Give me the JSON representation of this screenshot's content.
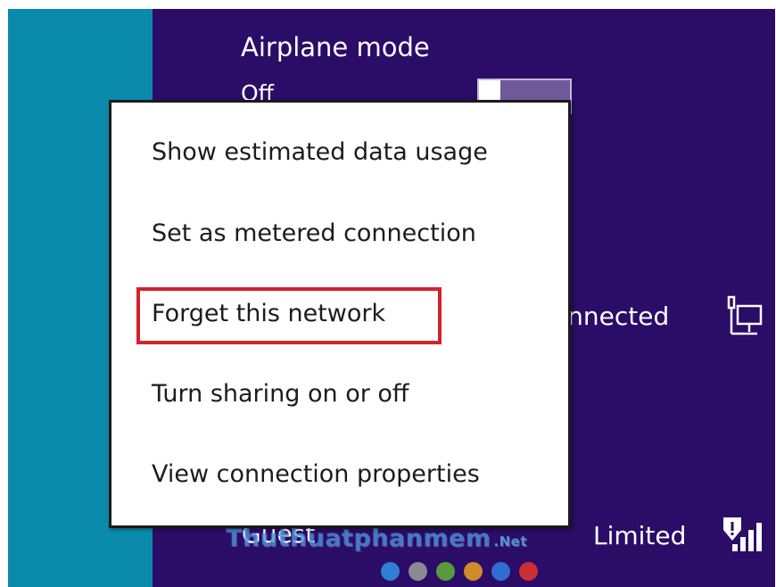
{
  "colors": {
    "left_pane": "#0b8bab",
    "network_pane": "#2b0c67",
    "menu_background": "#ffffff",
    "highlight": "#d4212c"
  },
  "airplane_mode": {
    "title": "Airplane mode",
    "state": "Off"
  },
  "networks": [
    {
      "name": "",
      "status": "onnected",
      "icon": "ethernet-icon"
    },
    {
      "name": "Guest",
      "status": "Limited",
      "icon": "wifi-signal-warning-icon"
    }
  ],
  "context_menu": {
    "items": [
      {
        "label": "Show estimated data usage"
      },
      {
        "label": "Set as metered connection"
      },
      {
        "label": "Forget this network",
        "highlighted": true
      },
      {
        "label": "Turn sharing on or off"
      },
      {
        "label": "View connection properties"
      }
    ]
  },
  "watermark": {
    "text": "Thuthuatphanmem",
    "suffix": ".Net",
    "dot_colors": [
      "#2f7fd4",
      "#8a8a96",
      "#5a9a3c",
      "#d08a2a",
      "#2e6ed0",
      "#c92f36"
    ]
  }
}
